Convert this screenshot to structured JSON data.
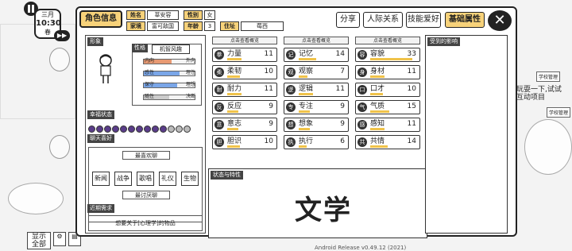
{
  "hud": {
    "month": "三月",
    "time": "10:30",
    "day_label": "春",
    "fast_forward": "▶▶",
    "show_all": "显示\n全部",
    "pause": "II"
  },
  "side": {
    "text_line1": "玩耍一下,试试",
    "text_line2": "互动项目",
    "note1": "学校管理",
    "note2": "学校管理"
  },
  "panel": {
    "tab_main": "角色信息",
    "tags": {
      "surname_k": "姓名",
      "surname_v": "莘安容",
      "gender_k": "性别",
      "gender_v": "女",
      "family_k": "家境",
      "family_v": "富可敌国",
      "age_k": "年龄",
      "age_v": "3",
      "addr_k": "住址",
      "addr_v": "莓西"
    },
    "buttons": {
      "share": "分享",
      "relations": "人际关系",
      "skills": "技能爱好",
      "base": "基础属性",
      "close": "✕"
    },
    "left": {
      "portrait_label": "形象",
      "personality_label": "性格",
      "personality_value": "机智风趣",
      "personality": [
        {
          "left": "内向",
          "right": "外向",
          "value": 0.55,
          "color": "#e89a73"
        },
        {
          "left": "感性",
          "right": "理性",
          "value": 0.7,
          "color": "#7aa6e8"
        },
        {
          "left": "保守",
          "right": "理想",
          "value": 0.65,
          "color": "#7aa6e8"
        },
        {
          "left": "随性",
          "right": "决断",
          "value": 0.5,
          "color": "#cccccc"
        }
      ],
      "happiness_label": "幸福状态",
      "happiness_full": 10,
      "happiness_total": 13,
      "chat_label": "聊天喜好",
      "like_label": "最喜欢聊",
      "dislike_label": "最讨厌聊",
      "topics": [
        "新闻",
        "战争",
        "歌唱",
        "礼仪",
        "生物"
      ],
      "need_label": "近期需求",
      "need_text": "想要关于[心理学]的物品"
    },
    "stats_hint": "点击查看概览",
    "stats": [
      [
        {
          "name": "力量",
          "value": "11",
          "icon": "拳"
        },
        {
          "name": "柔韧",
          "value": "10",
          "icon": "柔"
        },
        {
          "name": "耐力",
          "value": "11",
          "icon": "耐"
        },
        {
          "name": "反应",
          "value": "9",
          "icon": "反"
        },
        {
          "name": "意志",
          "value": "9",
          "icon": "意"
        },
        {
          "name": "胆识",
          "value": "10",
          "icon": "胆"
        }
      ],
      [
        {
          "name": "记忆",
          "value": "14",
          "icon": "记"
        },
        {
          "name": "观察",
          "value": "7",
          "icon": "观"
        },
        {
          "name": "逻辑",
          "value": "11",
          "icon": "逻"
        },
        {
          "name": "专注",
          "value": "9",
          "icon": "专"
        },
        {
          "name": "想象",
          "value": "9",
          "icon": "想"
        },
        {
          "name": "执行",
          "value": "6",
          "icon": "执"
        }
      ],
      [
        {
          "name": "容貌",
          "value": "33",
          "icon": "容"
        },
        {
          "name": "身材",
          "value": "11",
          "icon": "身"
        },
        {
          "name": "口才",
          "value": "10",
          "icon": "口"
        },
        {
          "name": "气质",
          "value": "15",
          "icon": "气"
        },
        {
          "name": "感知",
          "value": "11",
          "icon": "感"
        },
        {
          "name": "共情",
          "value": "14",
          "icon": "共"
        }
      ]
    ],
    "traits_label": "状态与特性",
    "trait_big": "文学",
    "impact_label": "受到的影响"
  },
  "footer": "Android Release v0.49.12 (2021)"
}
